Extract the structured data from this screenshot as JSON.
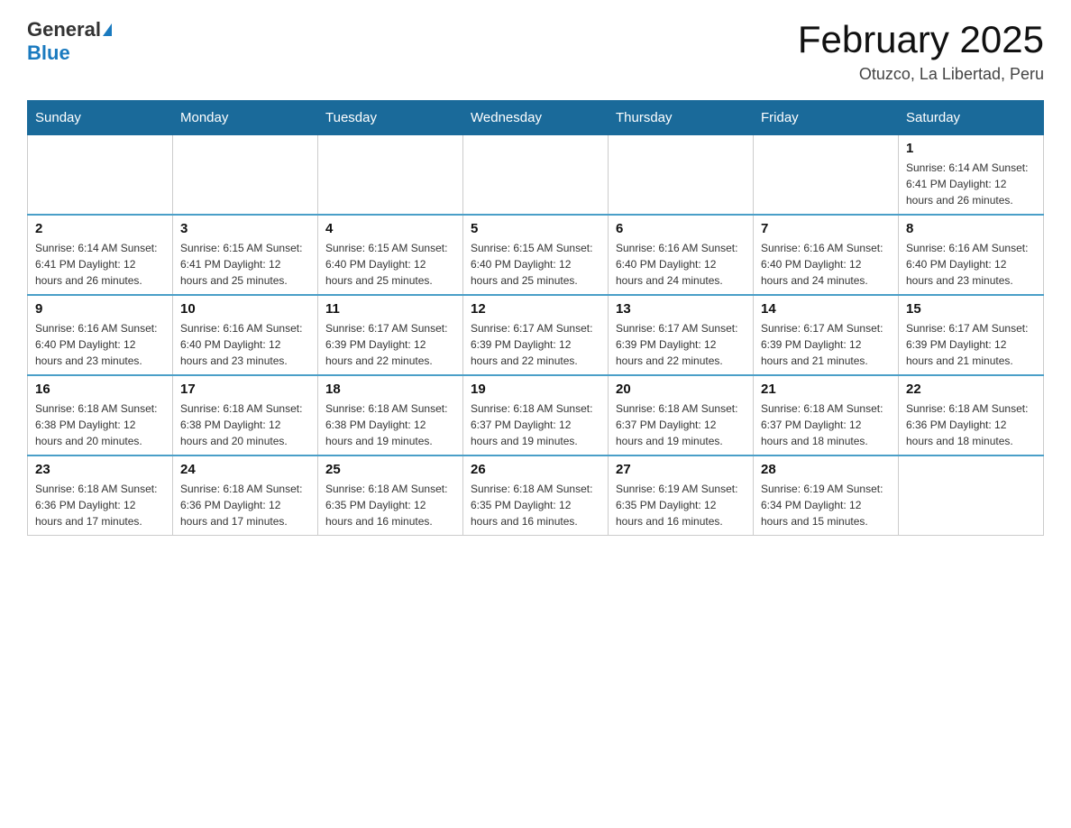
{
  "header": {
    "logo_general": "General",
    "logo_blue": "Blue",
    "title": "February 2025",
    "subtitle": "Otuzco, La Libertad, Peru"
  },
  "weekdays": [
    "Sunday",
    "Monday",
    "Tuesday",
    "Wednesday",
    "Thursday",
    "Friday",
    "Saturday"
  ],
  "weeks": [
    [
      {
        "day": "",
        "info": ""
      },
      {
        "day": "",
        "info": ""
      },
      {
        "day": "",
        "info": ""
      },
      {
        "day": "",
        "info": ""
      },
      {
        "day": "",
        "info": ""
      },
      {
        "day": "",
        "info": ""
      },
      {
        "day": "1",
        "info": "Sunrise: 6:14 AM\nSunset: 6:41 PM\nDaylight: 12 hours and 26 minutes."
      }
    ],
    [
      {
        "day": "2",
        "info": "Sunrise: 6:14 AM\nSunset: 6:41 PM\nDaylight: 12 hours and 26 minutes."
      },
      {
        "day": "3",
        "info": "Sunrise: 6:15 AM\nSunset: 6:41 PM\nDaylight: 12 hours and 25 minutes."
      },
      {
        "day": "4",
        "info": "Sunrise: 6:15 AM\nSunset: 6:40 PM\nDaylight: 12 hours and 25 minutes."
      },
      {
        "day": "5",
        "info": "Sunrise: 6:15 AM\nSunset: 6:40 PM\nDaylight: 12 hours and 25 minutes."
      },
      {
        "day": "6",
        "info": "Sunrise: 6:16 AM\nSunset: 6:40 PM\nDaylight: 12 hours and 24 minutes."
      },
      {
        "day": "7",
        "info": "Sunrise: 6:16 AM\nSunset: 6:40 PM\nDaylight: 12 hours and 24 minutes."
      },
      {
        "day": "8",
        "info": "Sunrise: 6:16 AM\nSunset: 6:40 PM\nDaylight: 12 hours and 23 minutes."
      }
    ],
    [
      {
        "day": "9",
        "info": "Sunrise: 6:16 AM\nSunset: 6:40 PM\nDaylight: 12 hours and 23 minutes."
      },
      {
        "day": "10",
        "info": "Sunrise: 6:16 AM\nSunset: 6:40 PM\nDaylight: 12 hours and 23 minutes."
      },
      {
        "day": "11",
        "info": "Sunrise: 6:17 AM\nSunset: 6:39 PM\nDaylight: 12 hours and 22 minutes."
      },
      {
        "day": "12",
        "info": "Sunrise: 6:17 AM\nSunset: 6:39 PM\nDaylight: 12 hours and 22 minutes."
      },
      {
        "day": "13",
        "info": "Sunrise: 6:17 AM\nSunset: 6:39 PM\nDaylight: 12 hours and 22 minutes."
      },
      {
        "day": "14",
        "info": "Sunrise: 6:17 AM\nSunset: 6:39 PM\nDaylight: 12 hours and 21 minutes."
      },
      {
        "day": "15",
        "info": "Sunrise: 6:17 AM\nSunset: 6:39 PM\nDaylight: 12 hours and 21 minutes."
      }
    ],
    [
      {
        "day": "16",
        "info": "Sunrise: 6:18 AM\nSunset: 6:38 PM\nDaylight: 12 hours and 20 minutes."
      },
      {
        "day": "17",
        "info": "Sunrise: 6:18 AM\nSunset: 6:38 PM\nDaylight: 12 hours and 20 minutes."
      },
      {
        "day": "18",
        "info": "Sunrise: 6:18 AM\nSunset: 6:38 PM\nDaylight: 12 hours and 19 minutes."
      },
      {
        "day": "19",
        "info": "Sunrise: 6:18 AM\nSunset: 6:37 PM\nDaylight: 12 hours and 19 minutes."
      },
      {
        "day": "20",
        "info": "Sunrise: 6:18 AM\nSunset: 6:37 PM\nDaylight: 12 hours and 19 minutes."
      },
      {
        "day": "21",
        "info": "Sunrise: 6:18 AM\nSunset: 6:37 PM\nDaylight: 12 hours and 18 minutes."
      },
      {
        "day": "22",
        "info": "Sunrise: 6:18 AM\nSunset: 6:36 PM\nDaylight: 12 hours and 18 minutes."
      }
    ],
    [
      {
        "day": "23",
        "info": "Sunrise: 6:18 AM\nSunset: 6:36 PM\nDaylight: 12 hours and 17 minutes."
      },
      {
        "day": "24",
        "info": "Sunrise: 6:18 AM\nSunset: 6:36 PM\nDaylight: 12 hours and 17 minutes."
      },
      {
        "day": "25",
        "info": "Sunrise: 6:18 AM\nSunset: 6:35 PM\nDaylight: 12 hours and 16 minutes."
      },
      {
        "day": "26",
        "info": "Sunrise: 6:18 AM\nSunset: 6:35 PM\nDaylight: 12 hours and 16 minutes."
      },
      {
        "day": "27",
        "info": "Sunrise: 6:19 AM\nSunset: 6:35 PM\nDaylight: 12 hours and 16 minutes."
      },
      {
        "day": "28",
        "info": "Sunrise: 6:19 AM\nSunset: 6:34 PM\nDaylight: 12 hours and 15 minutes."
      },
      {
        "day": "",
        "info": ""
      }
    ]
  ]
}
